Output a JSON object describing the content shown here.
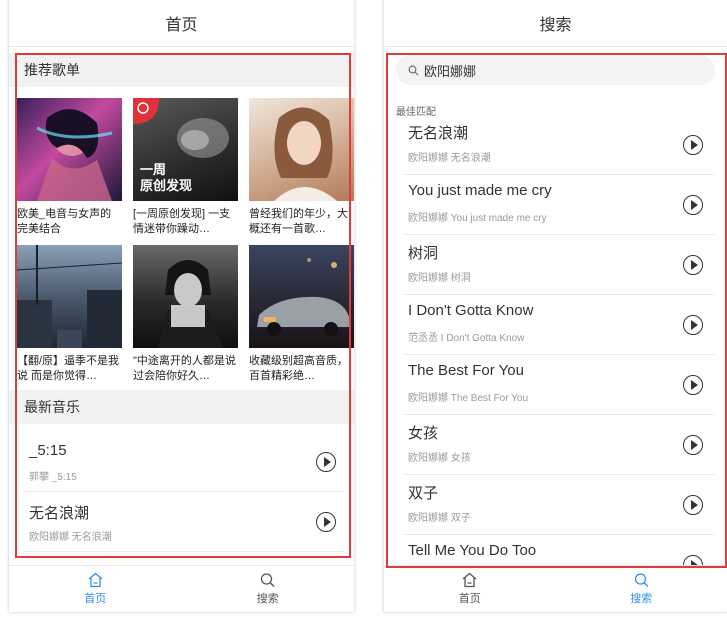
{
  "left": {
    "header_title": "首页",
    "recommend_title": "推荐歌单",
    "playlists": [
      {
        "title": "欧美_电音与女声的完美结合"
      },
      {
        "title": "[一周原创发现] 一支情迷带你躁动…",
        "badge_line1": "一周",
        "badge_line2": "原创发现"
      },
      {
        "title": "曾经我们的年少，大概还有一首歌…"
      },
      {
        "title": "【翻/原】逼季不是我说 而是你觉得…"
      },
      {
        "title": "\"中途离开的人都是说过会陪你好久…"
      },
      {
        "title": "收藏级别超高音质，百首精彩绝…"
      }
    ],
    "latest_title": "最新音乐",
    "songs": [
      {
        "name": "_5:15",
        "sub": "郭攀 _5:15"
      },
      {
        "name": "无名浪潮",
        "sub": "欧阳娜娜 无名浪潮"
      }
    ]
  },
  "right": {
    "header_title": "搜索",
    "search_value": "欧阳娜娜",
    "best_match_label": "最佳匹配",
    "results": [
      {
        "name": "无名浪潮",
        "sub": "欧阳娜娜 无名浪潮"
      },
      {
        "name": "You just made me cry",
        "sub": "欧阳娜娜 You just made me cry"
      },
      {
        "name": "树洞",
        "sub": "欧阳娜娜 树洞"
      },
      {
        "name": "I Don't Gotta Know",
        "sub": "范丞丞 I Don't Gotta Know"
      },
      {
        "name": "The Best For You",
        "sub": "欧阳娜娜 The Best For You"
      },
      {
        "name": "女孩",
        "sub": "欧阳娜娜 女孩"
      },
      {
        "name": "双子",
        "sub": "欧阳娜娜 双子"
      },
      {
        "name": "Tell Me You Do Too",
        "sub": ""
      }
    ]
  },
  "tabs": [
    {
      "label": "首页",
      "icon": "home-icon"
    },
    {
      "label": "搜索",
      "icon": "search-icon"
    }
  ],
  "colors": {
    "accent": "#2f8ff0",
    "highlight_frame": "#e03a3a"
  }
}
